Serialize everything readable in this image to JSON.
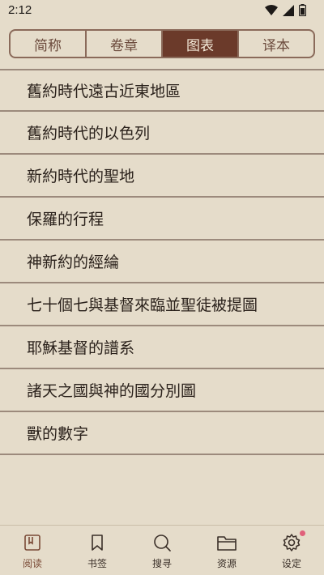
{
  "status": {
    "time": "2:12"
  },
  "tabs": [
    {
      "label": "简称"
    },
    {
      "label": "卷章"
    },
    {
      "label": "图表",
      "active": true
    },
    {
      "label": "译本"
    }
  ],
  "list": [
    {
      "label": "舊約時代遠古近東地區"
    },
    {
      "label": "舊約時代的以色列"
    },
    {
      "label": "新約時代的聖地"
    },
    {
      "label": "保羅的行程"
    },
    {
      "label": "神新約的經綸"
    },
    {
      "label": "七十個七與基督來臨並聖徒被提圖"
    },
    {
      "label": "耶穌基督的譜系"
    },
    {
      "label": "諸天之國與神的國分別圖"
    },
    {
      "label": "獸的數字"
    }
  ],
  "bottom_nav": [
    {
      "label": "阅读",
      "icon": "book-icon",
      "active": true
    },
    {
      "label": "书签",
      "icon": "bookmark-icon"
    },
    {
      "label": "搜寻",
      "icon": "search-icon"
    },
    {
      "label": "资源",
      "icon": "folder-icon"
    },
    {
      "label": "设定",
      "icon": "gear-icon",
      "notification": true
    }
  ],
  "colors": {
    "background": "#e5dcca",
    "accent": "#6b3a2a",
    "notification": "#e0607a"
  }
}
